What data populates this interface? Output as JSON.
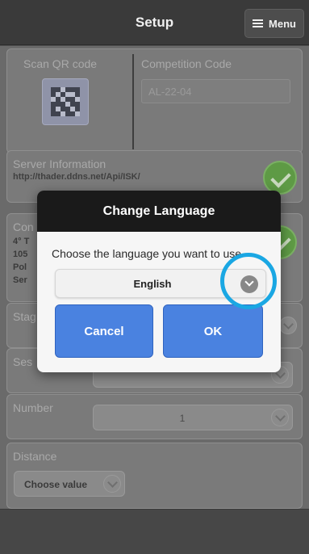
{
  "header": {
    "title": "Setup",
    "menu_label": "Menu"
  },
  "qr_card": {
    "scan_label": "Scan QR code",
    "competition_label": "Competition Code",
    "competition_placeholder": "AL-22-04"
  },
  "server_card": {
    "label": "Server Information",
    "url": "http://thader.ddns.net/Api/ISK/"
  },
  "competition_card": {
    "label_partial": "Con",
    "lines": [
      "4° T",
      "105",
      "Pol",
      "Ser"
    ]
  },
  "stage_card": {
    "label_partial": "Stag"
  },
  "session_card": {
    "label_partial": "Ses"
  },
  "number_card": {
    "label": "Number",
    "value": "1"
  },
  "distance_card": {
    "label": "Distance",
    "placeholder": "Choose value"
  },
  "dialog": {
    "title": "Change Language",
    "prompt": "Choose the language you want to use",
    "selected_language": "English",
    "cancel_label": "Cancel",
    "ok_label": "OK"
  },
  "colors": {
    "accent_blue": "#4a82e0",
    "highlight_ring": "#1aa7e3",
    "success_green": "#5e9a45"
  },
  "icons": [
    "hamburger-icon",
    "qr-code-icon",
    "check-icon",
    "chevron-down-icon"
  ]
}
